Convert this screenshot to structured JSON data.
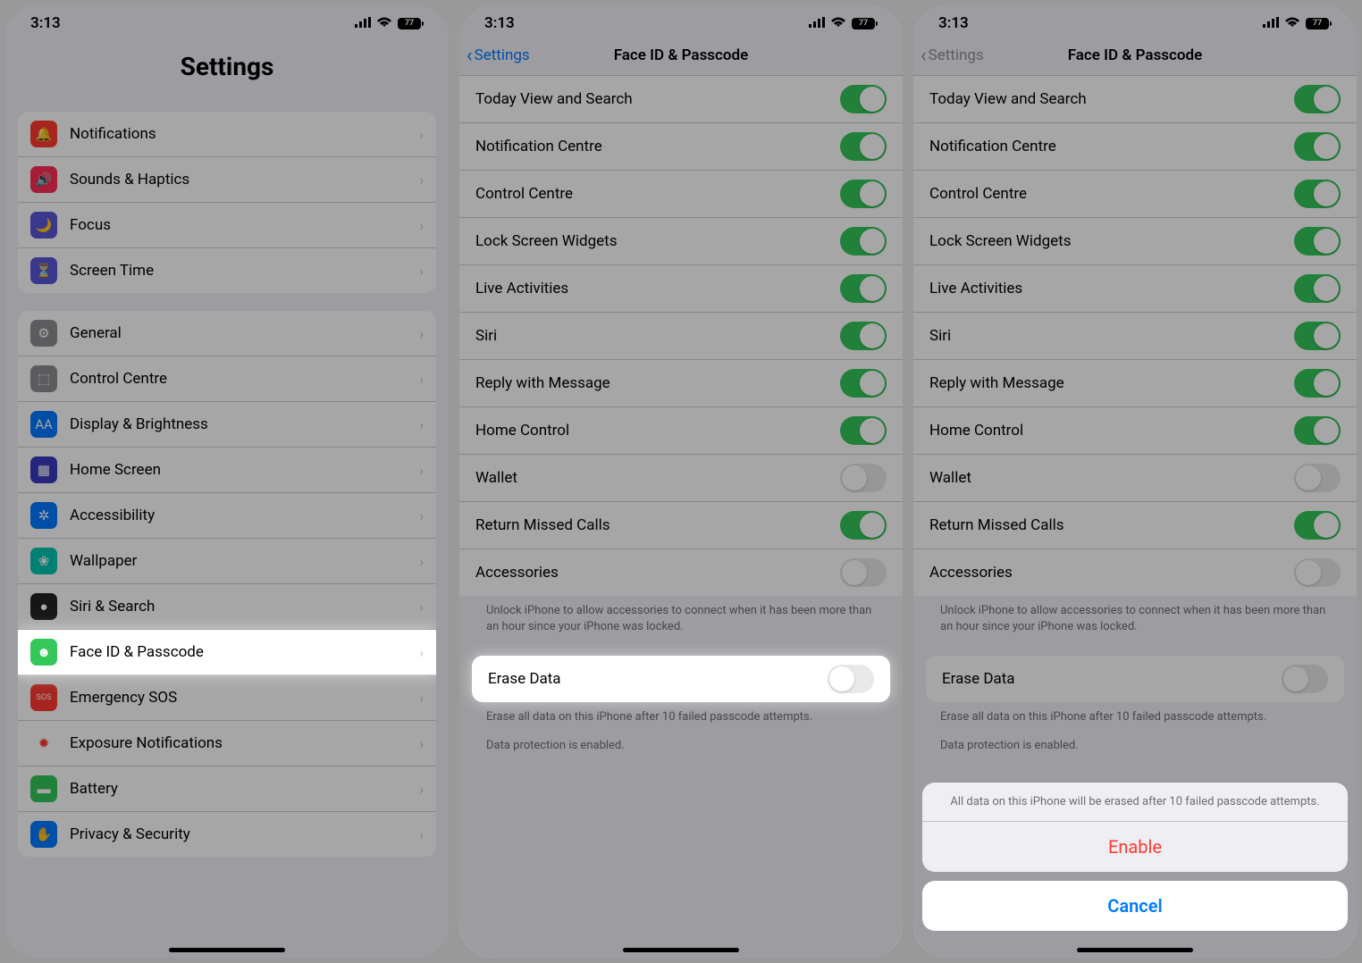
{
  "status": {
    "time": "3:13",
    "battery": "77"
  },
  "screen1": {
    "title": "Settings",
    "groups": [
      {
        "items": [
          {
            "label": "Notifications",
            "iconColor": "#ff3b30",
            "iconGlyph": "🔔"
          },
          {
            "label": "Sounds & Haptics",
            "iconColor": "#ff2d55",
            "iconGlyph": "🔊"
          },
          {
            "label": "Focus",
            "iconColor": "#5856d6",
            "iconGlyph": "🌙"
          },
          {
            "label": "Screen Time",
            "iconColor": "#5856d6",
            "iconGlyph": "⏳"
          }
        ]
      },
      {
        "items": [
          {
            "label": "General",
            "iconColor": "#8e8e93",
            "iconGlyph": "⚙"
          },
          {
            "label": "Control Centre",
            "iconColor": "#8e8e93",
            "iconGlyph": "⬚"
          },
          {
            "label": "Display & Brightness",
            "iconColor": "#007aff",
            "iconGlyph": "AA"
          },
          {
            "label": "Home Screen",
            "iconColor": "#3a3ac0",
            "iconGlyph": "▦"
          },
          {
            "label": "Accessibility",
            "iconColor": "#007aff",
            "iconGlyph": "✲"
          },
          {
            "label": "Wallpaper",
            "iconColor": "#00c7b1",
            "iconGlyph": "❀"
          },
          {
            "label": "Siri & Search",
            "iconColor": "#222",
            "iconGlyph": "●"
          },
          {
            "label": "Face ID & Passcode",
            "iconColor": "#34c759",
            "iconGlyph": "☻",
            "highlight": true
          },
          {
            "label": "Emergency SOS",
            "iconColor": "#ff3b30",
            "iconGlyph": "SOS"
          },
          {
            "label": "Exposure Notifications",
            "iconColor": "#fff",
            "iconGlyph": "✹",
            "iconFg": "#ff3b30"
          },
          {
            "label": "Battery",
            "iconColor": "#34c759",
            "iconGlyph": "▬"
          },
          {
            "label": "Privacy & Security",
            "iconColor": "#007aff",
            "iconGlyph": "✋"
          }
        ]
      }
    ]
  },
  "screen2": {
    "back": "Settings",
    "title": "Face ID & Passcode",
    "toggles": [
      {
        "label": "Today View and Search",
        "on": true
      },
      {
        "label": "Notification Centre",
        "on": true
      },
      {
        "label": "Control Centre",
        "on": true
      },
      {
        "label": "Lock Screen Widgets",
        "on": true
      },
      {
        "label": "Live Activities",
        "on": true
      },
      {
        "label": "Siri",
        "on": true
      },
      {
        "label": "Reply with Message",
        "on": true
      },
      {
        "label": "Home Control",
        "on": true
      },
      {
        "label": "Wallet",
        "on": false
      },
      {
        "label": "Return Missed Calls",
        "on": true
      },
      {
        "label": "Accessories",
        "on": false
      }
    ],
    "accessoriesFooter": "Unlock iPhone to allow accessories to connect when it has been more than an hour since your iPhone was locked.",
    "eraseLabel": "Erase Data",
    "eraseOn": false,
    "eraseFooter1": "Erase all data on this iPhone after 10 failed passcode attempts.",
    "eraseFooter2": "Data protection is enabled."
  },
  "screen3": {
    "back": "Settings",
    "title": "Face ID & Passcode",
    "sheetMessage": "All data on this iPhone will be erased after 10 failed passcode attempts.",
    "enable": "Enable",
    "cancel": "Cancel"
  }
}
